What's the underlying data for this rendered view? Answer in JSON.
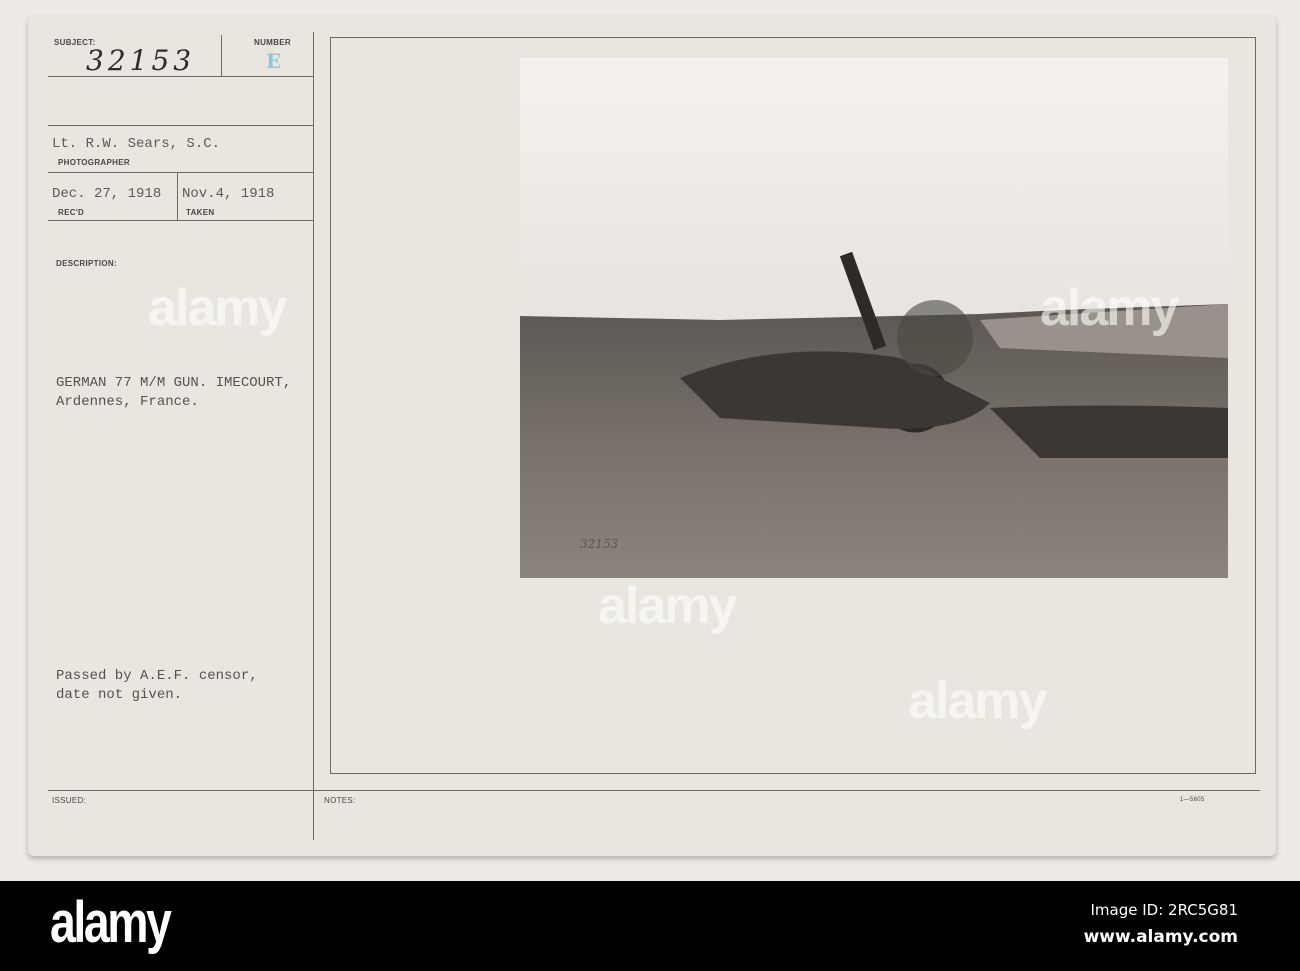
{
  "card": {
    "subject_label": "SUBJECT:",
    "subject_value": "32153",
    "number_label": "NUMBER",
    "number_stamp": "E",
    "photographer": "Lt. R.W. Sears, S.C.",
    "photographer_label": "PHOTOGRAPHER",
    "received": "Dec. 27, 1918",
    "received_label": "REC'D",
    "taken": "Nov.4, 1918",
    "taken_label": "TAKEN",
    "description_label": "DESCRIPTION:",
    "description_line1": "GERMAN 77 M/M GUN. IMECOURT,",
    "description_line2": "Ardennes, France.",
    "censor_line1": "Passed by A.E.F. censor,",
    "censor_line2": "date not given.",
    "issued_label": "ISSUED:",
    "notes_label": "NOTES:",
    "form_number": "1—5605",
    "photo_inscription": "32153"
  },
  "watermark": "alamy",
  "banner": {
    "logo": "alamy",
    "image_id": "Image ID: 2RC5G81",
    "url": "www.alamy.com"
  }
}
